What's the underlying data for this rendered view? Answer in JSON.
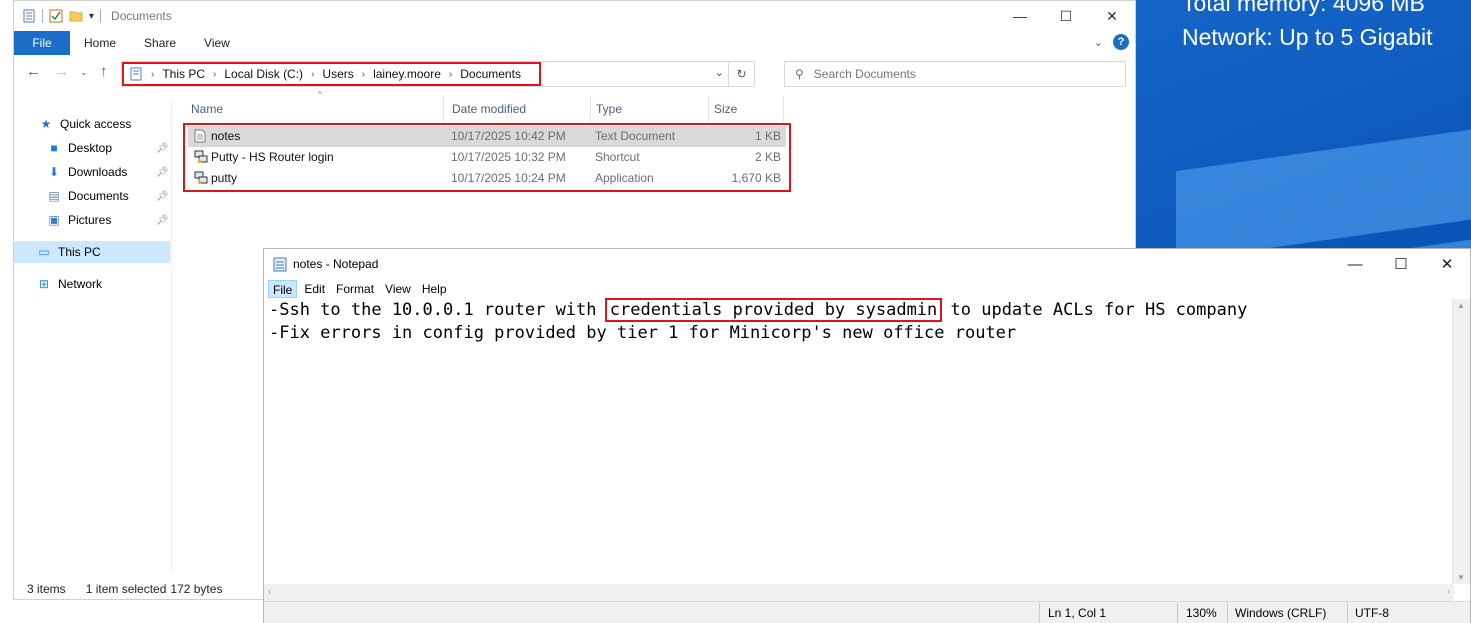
{
  "desktop": {
    "line1": "Total memory: 4096 MB",
    "line2": "Network: Up to 5 Gigabit"
  },
  "explorer": {
    "title": "Documents",
    "ribbon_tabs": [
      "File",
      "Home",
      "Share",
      "View"
    ],
    "address": [
      "This PC",
      "Local Disk (C:)",
      "Users",
      "lainey.moore",
      "Documents"
    ],
    "search_placeholder": "Search Documents",
    "nav": {
      "quick_access": "Quick access",
      "pinned": [
        "Desktop",
        "Downloads",
        "Documents",
        "Pictures"
      ],
      "this_pc": "This PC",
      "network": "Network"
    },
    "columns": [
      "Name",
      "Date modified",
      "Type",
      "Size"
    ],
    "files": [
      {
        "name": "notes",
        "date": "10/17/2025 10:42 PM",
        "type": "Text Document",
        "size": "1 KB"
      },
      {
        "name": "Putty - HS Router login",
        "date": "10/17/2025 10:32 PM",
        "type": "Shortcut",
        "size": "2 KB"
      },
      {
        "name": "putty",
        "date": "10/17/2025 10:24 PM",
        "type": "Application",
        "size": "1,670 KB"
      }
    ],
    "status": {
      "items": "3 items",
      "selected": "1 item selected",
      "size": "172 bytes"
    }
  },
  "notepad": {
    "title": "notes - Notepad",
    "menu": [
      "File",
      "Edit",
      "Format",
      "View",
      "Help"
    ],
    "line1_pre": "-Ssh to the 10.0.0.1 router with ",
    "line1_highlight": "credentials provided by sysadmin",
    "line1_post": " to update ACLs for HS company",
    "line2": "-Fix errors in config provided by tier 1 for Minicorp's new office router",
    "status": {
      "position": "Ln 1, Col 1",
      "zoom": "130%",
      "eol": "Windows (CRLF)",
      "encoding": "UTF-8"
    }
  }
}
